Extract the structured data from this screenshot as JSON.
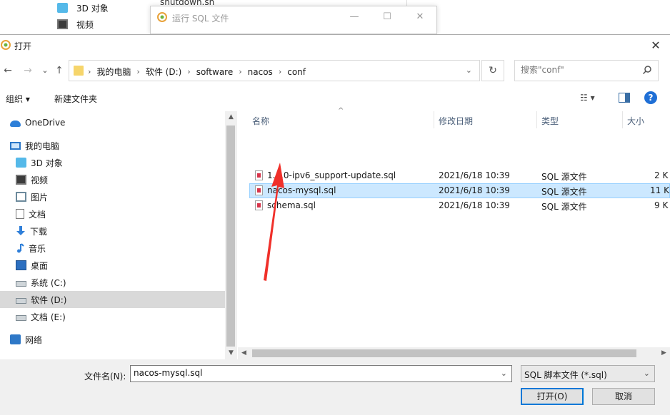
{
  "background": {
    "explorer_items": [
      {
        "label": "3D 对象",
        "icon": "3d-objects-icon"
      },
      {
        "label": "视频",
        "icon": "video-icon"
      }
    ],
    "file_label": "shutdown.sh",
    "sql_window": {
      "title": "运行 SQL 文件",
      "minimize": "—",
      "maximize": "☐",
      "close": "✕"
    }
  },
  "dialog": {
    "title": "打开",
    "close": "✕",
    "nav": {
      "back": "←",
      "forward": "→",
      "recent": "⌄",
      "up": "↑"
    },
    "breadcrumbs": [
      "我的电脑",
      "软件 (D:)",
      "software",
      "nacos",
      "conf"
    ],
    "refresh": "↻",
    "search_placeholder": "搜索\"conf\"",
    "toolbar": {
      "organize": "组织 ▾",
      "new_folder": "新建文件夹",
      "help": "?"
    },
    "sidebar": [
      {
        "label": "OneDrive",
        "icon": "onedrive-icon"
      },
      {
        "label": "我的电脑",
        "icon": "this-pc-icon"
      },
      {
        "label": "3D 对象",
        "icon": "3d-objects-icon"
      },
      {
        "label": "视频",
        "icon": "videos-icon"
      },
      {
        "label": "图片",
        "icon": "pictures-icon"
      },
      {
        "label": "文档",
        "icon": "documents-icon"
      },
      {
        "label": "下载",
        "icon": "downloads-icon"
      },
      {
        "label": "音乐",
        "icon": "music-icon"
      },
      {
        "label": "桌面",
        "icon": "desktop-icon"
      },
      {
        "label": "系统 (C:)",
        "icon": "drive-icon"
      },
      {
        "label": "软件 (D:)",
        "icon": "drive-icon",
        "selected": true
      },
      {
        "label": "文档 (E:)",
        "icon": "drive-icon"
      },
      {
        "label": "网络",
        "icon": "network-icon"
      }
    ],
    "columns": {
      "name": "名称",
      "modified": "修改日期",
      "type": "类型",
      "size": "大小"
    },
    "files": [
      {
        "name": "1.4.0-ipv6_support-update.sql",
        "modified": "2021/6/18 10:39",
        "type": "SQL 源文件",
        "size": "2 K"
      },
      {
        "name": "nacos-mysql.sql",
        "modified": "2021/6/18 10:39",
        "type": "SQL 源文件",
        "size": "11 K",
        "selected": true
      },
      {
        "name": "schema.sql",
        "modified": "2021/6/18 10:39",
        "type": "SQL 源文件",
        "size": "9 K"
      }
    ],
    "filename_label": "文件名(N):",
    "filename_value": "nacos-mysql.sql",
    "filter_value": "SQL 脚本文件 (*.sql)",
    "open_button": "打开(O)",
    "cancel_button": "取消"
  },
  "colors": {
    "selection": "#cce8ff",
    "selection_border": "#99d1ff",
    "sidebar_selected": "#d9d9d9",
    "annotation_arrow": "#f0302a",
    "primary_button_border": "#0078d7"
  }
}
